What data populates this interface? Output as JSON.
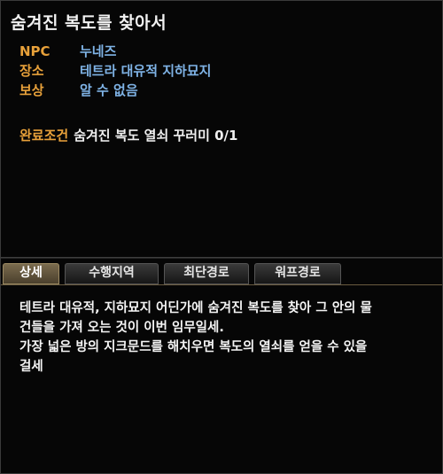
{
  "quest": {
    "title": "숨겨진 복도를 찾아서",
    "npc_label": "NPC",
    "npc_value": "누네즈",
    "place_label": "장소",
    "place_value": "테트라 대유적 지하묘지",
    "reward_label": "보상",
    "reward_value": "알 수 없음",
    "condition_label": "완료조건",
    "condition_value": "숨겨진 복도 열쇠 꾸러미 0/1"
  },
  "tabs": [
    {
      "label": "상세"
    },
    {
      "label": "수행지역"
    },
    {
      "label": "최단경로"
    },
    {
      "label": "워프경로"
    }
  ],
  "description": [
    "테트라 대유적, 지하묘지 어딘가에 숨겨진 복도를 찾아 그 안의 물",
    "건들을 가져 오는 것이 이번 임무일세.",
    "가장 넓은 방의 지크문드를 해치우면 복도의 열쇠를 얻을 수 있을",
    " 걸세"
  ],
  "colors": {
    "label": "#e8a13a",
    "value": "#7fb3e6",
    "active_tab": "#7a6b4e"
  }
}
